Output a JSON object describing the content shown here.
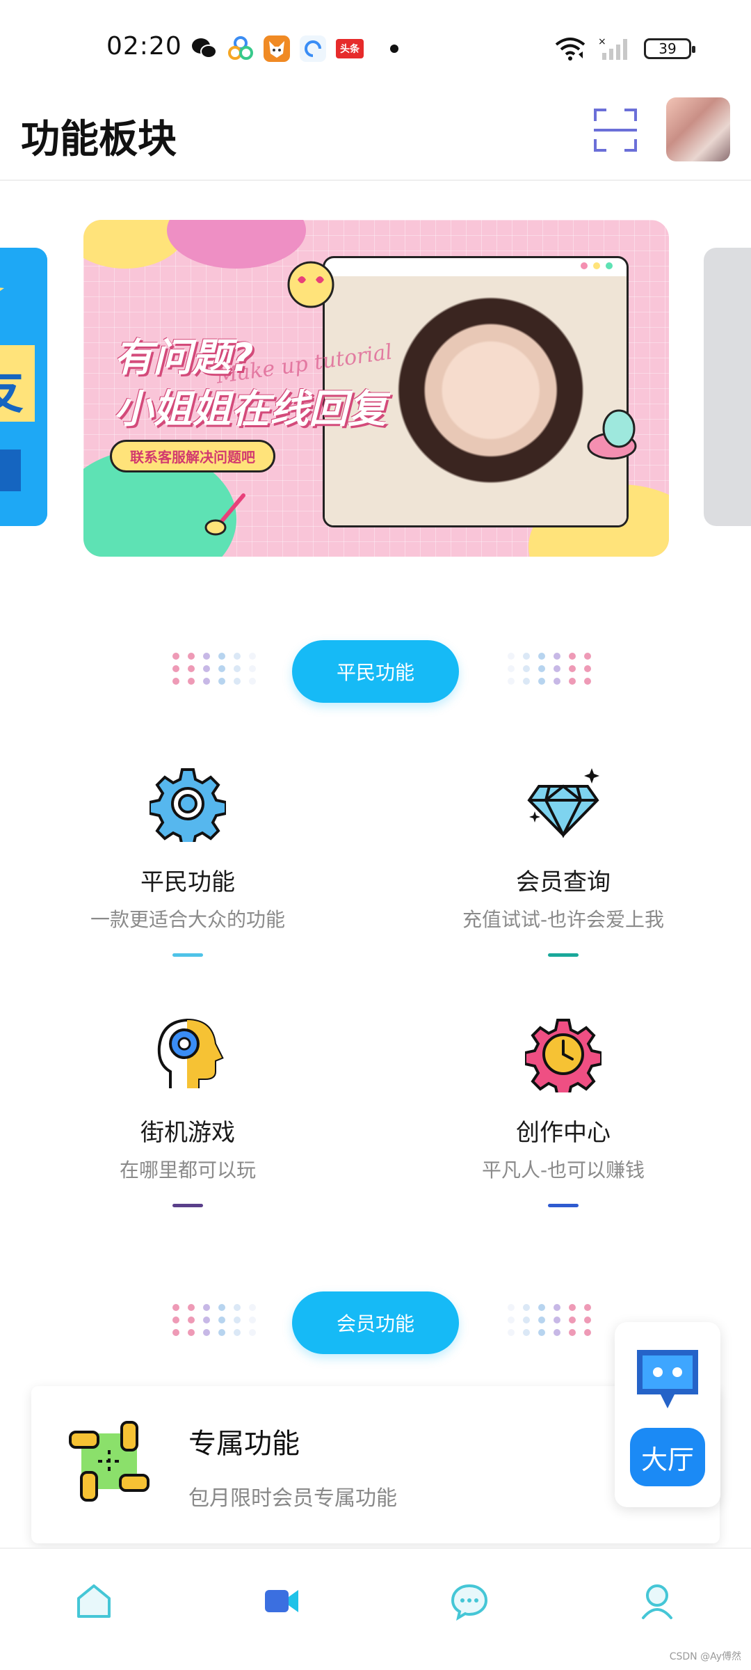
{
  "status_bar": {
    "time": "02:20",
    "app_icons": [
      "wechat-icon",
      "cluster-app-icon",
      "fox-app-icon",
      "browser-app-icon",
      "toutiao-icon"
    ],
    "toutiao_label": "头条",
    "battery": "39"
  },
  "header": {
    "title": "功能板块",
    "scan_icon": "scan-icon",
    "avatar": "user-avatar"
  },
  "banner": {
    "headline_line1": "有问题?",
    "headline_line2": "小姐姐在线回复",
    "script_text": "Make up tutorial",
    "pill": "联系客服解决问题吧"
  },
  "sections": {
    "common": "平民功能",
    "member": "会员功能"
  },
  "features": [
    {
      "title": "平民功能",
      "subtitle": "一款更适合大众的功能",
      "icon": "gear-icon",
      "accent": "#4fc3e8"
    },
    {
      "title": "会员查询",
      "subtitle": "充值试试-也许会爱上我",
      "icon": "diamond-icon",
      "accent": "#1aa89a"
    },
    {
      "title": "街机游戏",
      "subtitle": "在哪里都可以玩",
      "icon": "head-gear-icon",
      "accent": "#5a3f8a"
    },
    {
      "title": "创作中心",
      "subtitle": "平凡人-也可以赚钱",
      "icon": "clock-gear-icon",
      "accent": "#2f5bd0"
    }
  ],
  "member_card": {
    "title": "专属功能",
    "subtitle": "包月限时会员专属功能",
    "icon": "hands-teamwork-icon"
  },
  "lobby": {
    "label": "大厅",
    "icon": "robot-chat-icon"
  },
  "bottom_nav": [
    "home-icon",
    "video-icon",
    "message-icon",
    "profile-icon"
  ],
  "watermark": "CSDN @Ay傅然",
  "colors": {
    "primary": "#16baf6",
    "lobby_button": "#1b8af5"
  }
}
